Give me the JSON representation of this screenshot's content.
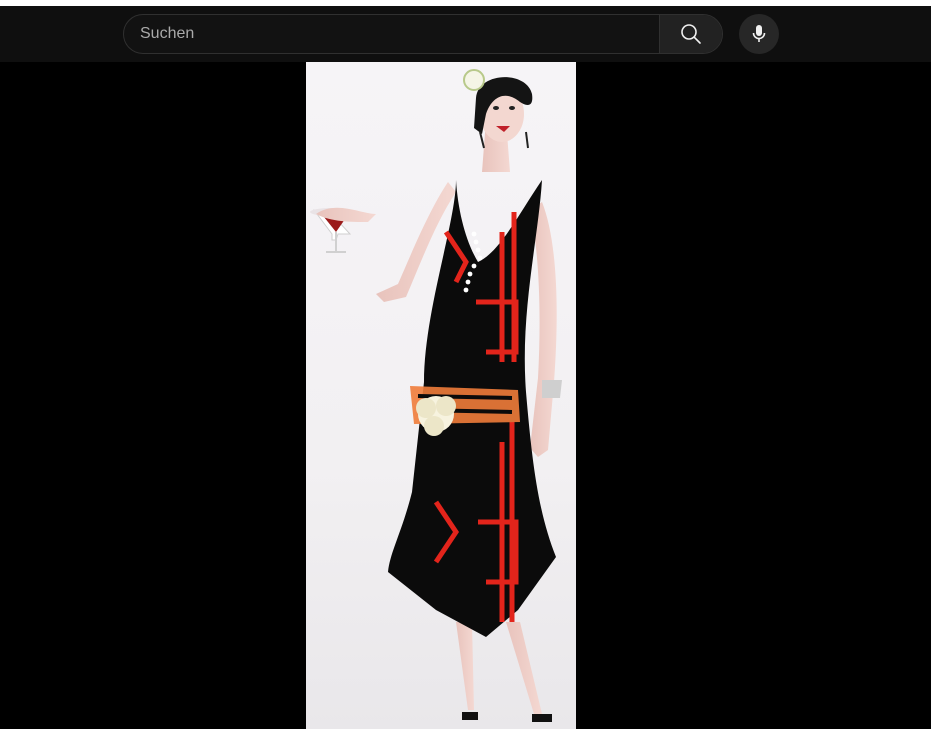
{
  "search": {
    "placeholder": "Suchen",
    "value": ""
  },
  "icons": {
    "search_button": "search-icon",
    "voice_button": "microphone-icon"
  },
  "video": {
    "frame_subject": "art-deco-flapper-illustration",
    "background_color": "#000000"
  },
  "colors": {
    "masthead": "#0f0f0f",
    "search_border": "#303030",
    "dress": "#0b0b0b",
    "dress_pattern": "#e3241b",
    "belt": "#f07c3a"
  }
}
